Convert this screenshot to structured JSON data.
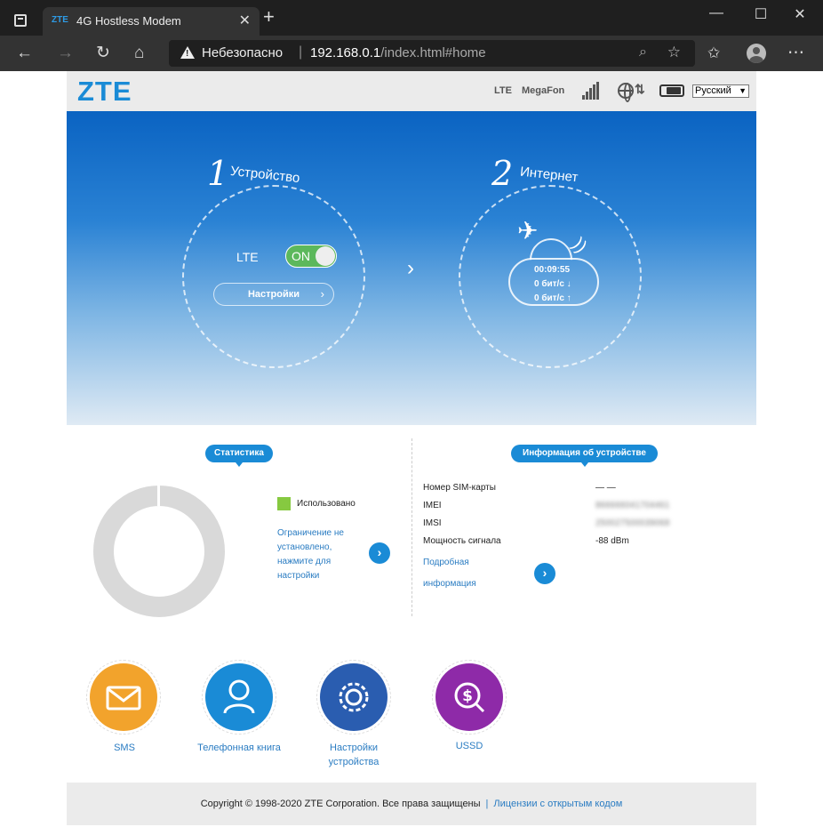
{
  "browser": {
    "tab_title": "4G Hostless Modem",
    "tab_favicon": "ZTE",
    "security_label": "Небезопасно",
    "url_host": "192.168.0.1",
    "url_path": "/index.html#home"
  },
  "header": {
    "logo": "ZTE",
    "network_type": "LTE",
    "operator": "MegaFon",
    "language": "Русский"
  },
  "hero": {
    "step1_number": "1",
    "step1_label": "Устройство",
    "step2_number": "2",
    "step2_label": "Интернет",
    "lte_label": "LTE",
    "toggle_label": "ON",
    "settings_button": "Настройки",
    "connection_time": "00:09:55",
    "download_speed": "0 бит/с ↓",
    "upload_speed": "0 бит/с ↑"
  },
  "stats": {
    "title": "Статистика",
    "legend_used": "Использовано",
    "used_color": "#86c940",
    "limit_link": "Ограничение не установлено, нажмите для настройки"
  },
  "device_info": {
    "title": "Информация об устройстве",
    "rows": [
      {
        "label": "Номер SIM-карты",
        "value": "— —"
      },
      {
        "label": "IMEI",
        "value": "866666041704461"
      },
      {
        "label": "IMSI",
        "value": "250027500039068"
      },
      {
        "label": "Мощность сигнала",
        "value": "-88 dBm"
      }
    ],
    "detail_link": "Подробная информация"
  },
  "shortcuts": {
    "sms": "SMS",
    "phonebook": "Телефонная книга",
    "settings": "Настройки устройства",
    "ussd": "USSD"
  },
  "footer": {
    "copyright": "Copyright © 1998-2020 ZTE Corporation. Все права защищены",
    "licenses_link": "Лицензии с открытым кодом"
  },
  "colors": {
    "accent": "#1a8bd6",
    "sms": "#f2a32c",
    "phonebook": "#1a8bd6",
    "settings": "#2a5db0",
    "ussd": "#8e2aa8"
  }
}
